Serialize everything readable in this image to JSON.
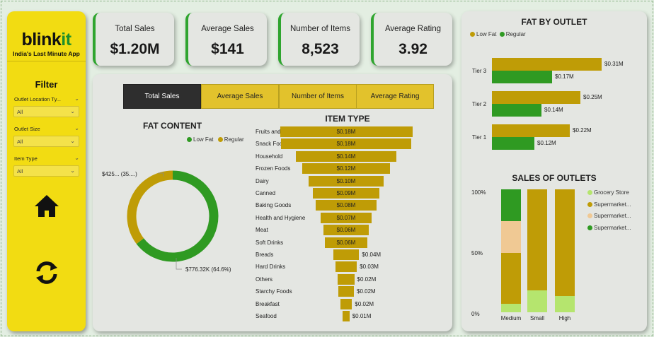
{
  "sidebar": {
    "logo_main": "blink",
    "logo_accent": "it",
    "tagline": "India's Last Minute App",
    "filter_title": "Filter",
    "slicers": [
      {
        "label": "Outlet Location Ty...",
        "value": "All"
      },
      {
        "label": "Outlet Size",
        "value": "All"
      },
      {
        "label": "Item Type",
        "value": "All"
      }
    ],
    "icons": [
      "home-icon",
      "refresh-icon"
    ]
  },
  "kpis": [
    {
      "label": "Total Sales",
      "value": "$1.20M"
    },
    {
      "label": "Average Sales",
      "value": "$141"
    },
    {
      "label": "Number of Items",
      "value": "8,523"
    },
    {
      "label": "Average Rating",
      "value": "3.92"
    }
  ],
  "tabs": [
    "Total Sales",
    "Average Sales",
    "Number of Items",
    "Average Rating"
  ],
  "active_tab": "Total Sales",
  "colors": {
    "low_fat": "#2f9a22",
    "regular": "#bf9c06",
    "grocery_store": "#b5e56e",
    "supermarket_1": "#bf9c06",
    "supermarket_2": "#f0c994",
    "supermarket_3": "#2f9a22",
    "accent_yellow": "#f2dc12"
  },
  "chart_data": [
    {
      "id": "fat_content",
      "type": "pie",
      "title": "FAT CONTENT",
      "legend": [
        "Low Fat",
        "Regular"
      ],
      "legend_position": "top-right",
      "slices": [
        {
          "name": "Low Fat",
          "value": 776.32,
          "label": "$776.32K (64.6%)"
        },
        {
          "name": "Regular",
          "value": 425.36,
          "label": "$425... (35....)"
        }
      ],
      "percent": [
        64.6,
        35.4
      ]
    },
    {
      "id": "item_type",
      "type": "bar",
      "title": "ITEM TYPE",
      "categories": [
        "Fruits and Vegetab...",
        "Snack Foods",
        "Household",
        "Frozen Foods",
        "Dairy",
        "Canned",
        "Baking Goods",
        "Health and Hygiene",
        "Meat",
        "Soft Drinks",
        "Breads",
        "Hard Drinks",
        "Others",
        "Starchy Foods",
        "Breakfast",
        "Seafood"
      ],
      "values": [
        0.178,
        0.175,
        0.136,
        0.118,
        0.101,
        0.09,
        0.081,
        0.068,
        0.06,
        0.058,
        0.035,
        0.029,
        0.022,
        0.021,
        0.016,
        0.009
      ],
      "labels": [
        "$0.18M",
        "$0.18M",
        "$0.14M",
        "$0.12M",
        "$0.10M",
        "$0.09M",
        "$0.08M",
        "$0.07M",
        "$0.06M",
        "$0.06M",
        "$0.04M",
        "$0.03M",
        "$0.02M",
        "$0.02M",
        "$0.02M",
        "$0.01M"
      ]
    },
    {
      "id": "fat_by_outlet",
      "type": "bar",
      "title": "FAT BY OUTLET",
      "legend": [
        "Low Fat",
        "Regular"
      ],
      "legend_position": "top-left",
      "categories": [
        "Tier 3",
        "Tier 2",
        "Tier 1"
      ],
      "series": [
        {
          "name": "Regular",
          "values": [
            0.31,
            0.25,
            0.22
          ],
          "labels": [
            "$0.31M",
            "$0.25M",
            "$0.22M"
          ]
        },
        {
          "name": "Low Fat",
          "values": [
            0.17,
            0.14,
            0.12
          ],
          "labels": [
            "$0.17M",
            "$0.14M",
            "$0.12M"
          ]
        }
      ]
    },
    {
      "id": "sales_of_outlets",
      "type": "bar",
      "stacked": "100%",
      "title": "SALES OF OUTLETS",
      "categories": [
        "Medium",
        "Small",
        "High"
      ],
      "y_ticks": [
        "100%",
        "50%",
        "0%"
      ],
      "ylim": [
        0,
        100
      ],
      "legend": [
        "Grocery Store",
        "Supermarket...",
        "Supermarket...",
        "Supermarket..."
      ],
      "legend_position": "right",
      "series": [
        {
          "name": "Grocery Store",
          "values": [
            7,
            18,
            13
          ]
        },
        {
          "name": "Supermarket...",
          "values": [
            41,
            82,
            87
          ]
        },
        {
          "name": "Supermarket...",
          "values": [
            26,
            0,
            0
          ]
        },
        {
          "name": "Supermarket...",
          "values": [
            26,
            0,
            0
          ]
        }
      ]
    }
  ]
}
